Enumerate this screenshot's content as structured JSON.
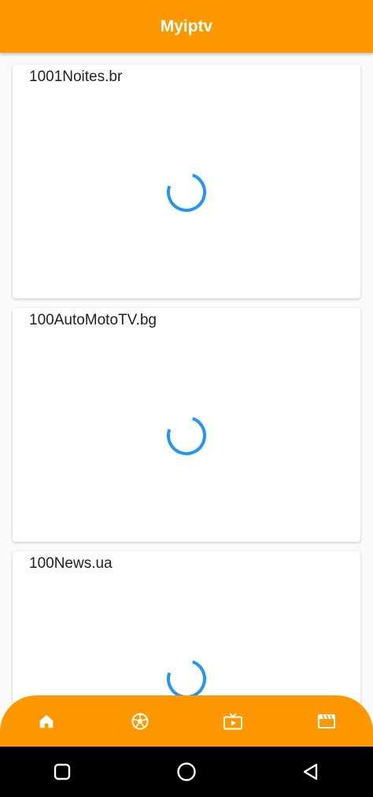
{
  "app_bar": {
    "title": "Myiptv"
  },
  "channels": [
    {
      "name": "1001Noites.br"
    },
    {
      "name": "100AutoMotoTV.bg"
    },
    {
      "name": "100News.ua"
    }
  ],
  "bottom_nav": {
    "items": [
      {
        "icon": "home-icon"
      },
      {
        "icon": "soccer-ball-icon"
      },
      {
        "icon": "live-tv-icon"
      },
      {
        "icon": "movie-clapper-icon"
      }
    ]
  },
  "system_nav": {
    "items": [
      {
        "icon": "recents-square-icon"
      },
      {
        "icon": "home-circle-icon"
      },
      {
        "icon": "back-triangle-icon"
      }
    ]
  },
  "colors": {
    "accent": "#ff9800",
    "spinner": "#2196f3"
  }
}
